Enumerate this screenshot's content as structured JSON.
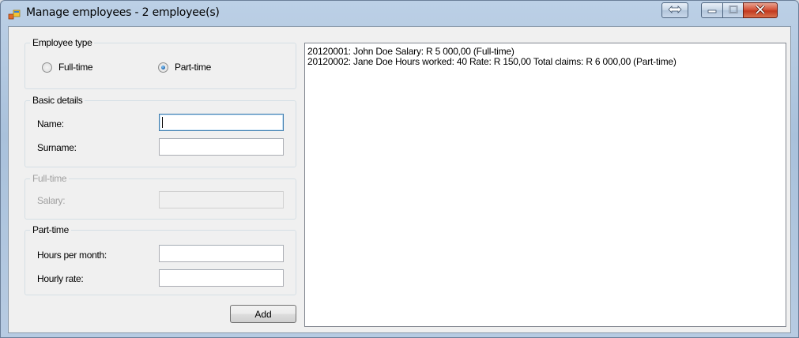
{
  "window": {
    "title": "Manage employees - 2 employee(s)"
  },
  "employee_type": {
    "title": "Employee type",
    "options": [
      {
        "label": "Full-time",
        "checked": false
      },
      {
        "label": "Part-time",
        "checked": true
      }
    ]
  },
  "basic_details": {
    "title": "Basic details",
    "name_label": "Name:",
    "name_value": "",
    "surname_label": "Surname:",
    "surname_value": ""
  },
  "full_time": {
    "title": "Full-time",
    "salary_label": "Salary:",
    "salary_value": "",
    "enabled": false
  },
  "part_time": {
    "title": "Part-time",
    "hours_label": "Hours per month:",
    "hours_value": "",
    "rate_label": "Hourly rate:",
    "rate_value": ""
  },
  "add_button": "Add",
  "employees": [
    "20120001:  John Doe Salary:  R 5 000,00 (Full-time)",
    "20120002:  Jane Doe Hours worked:  40 Rate:  R 150,00 Total claims:  R 6 000,00 (Part-time)"
  ],
  "icons": {
    "app": "app-icon",
    "swap": "swap-icon",
    "minimize": "minimize-icon",
    "maximize": "maximize-icon",
    "close": "close-icon"
  }
}
